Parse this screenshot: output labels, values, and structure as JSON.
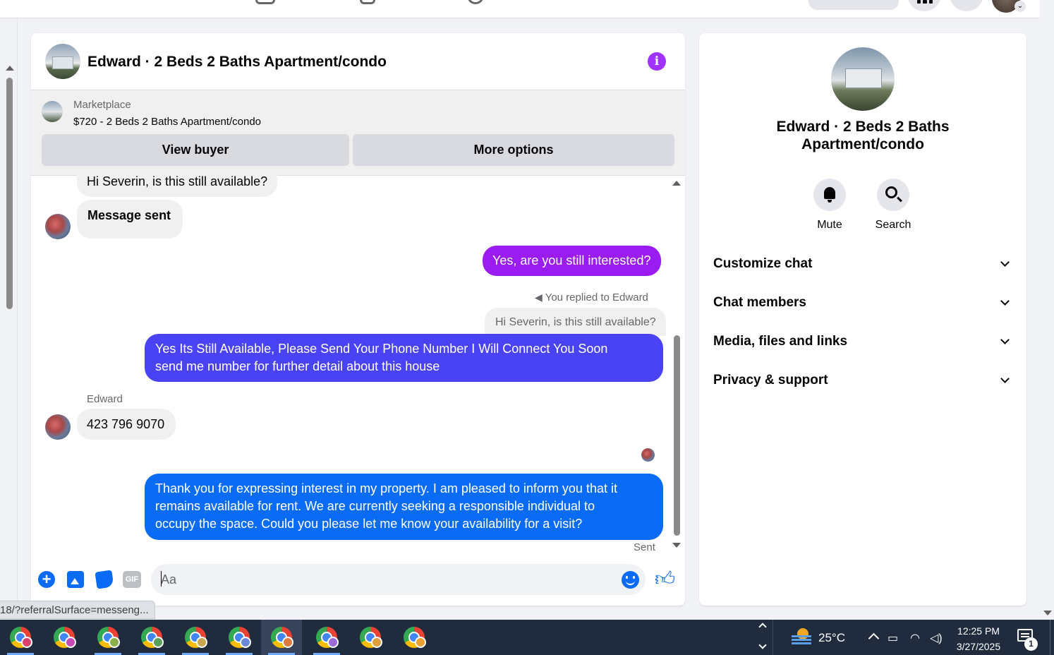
{
  "header": {
    "title": "Edward · 2 Beds 2 Baths Apartment/condo"
  },
  "marketplace": {
    "label": "Marketplace",
    "item": "$720 - 2 Beds 2 Baths Apartment/condo",
    "view_buyer": "View buyer",
    "more_options": "More options"
  },
  "messages": {
    "m1": "Hi Severin, is this still available?",
    "m2": "Message sent",
    "m3": "Yes, are you still interested?",
    "replied_to": "You replied to Edward",
    "quoted": "Hi Severin, is this still available?",
    "m4_line1": "Yes Its Still Available, Please Send Your Phone Number I Will Connect You Soon",
    "m4_line2": "send me number for further detail about this house",
    "sender_name": "Edward",
    "m5": "423 796 9070",
    "m6_line1": "Thank you for expressing interest in my property. I am pleased to inform you that it",
    "m6_line2": "remains available for rent. We are currently seeking a responsible individual to",
    "m6_line3": "occupy the space. Could you please let me know your availability for a visit?",
    "status": "Sent"
  },
  "composer": {
    "placeholder": "Aa",
    "gif_label": "GIF"
  },
  "info_panel": {
    "name_line1": "Edward · 2 Beds 2 Baths",
    "name_line2": "Apartment/condo",
    "mute": "Mute",
    "search": "Search",
    "sections": [
      "Customize chat",
      "Chat members",
      "Media, files and links",
      "Privacy & support"
    ]
  },
  "status_url": "18/?referralSurface=messeng...",
  "taskbar": {
    "temperature": "25°C",
    "time": "12:25 PM",
    "date": "3/27/2025",
    "notification_count": "1"
  },
  "colors": {
    "accent_purple": "#9b1cf2",
    "accent_indigo": "#4a43f5",
    "accent_blue": "#0a6cf5"
  }
}
